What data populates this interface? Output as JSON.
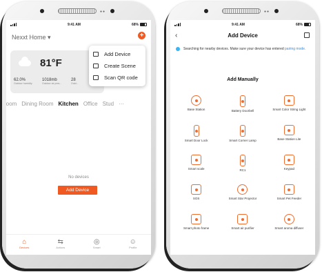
{
  "status": {
    "time": "9:41 AM",
    "battery": "68%"
  },
  "home": {
    "title": "Nexxt Home",
    "weather": {
      "temp": "81°F",
      "humidity": "62.0%",
      "humidity_label": "Outdoor humidity",
      "pressure": "1018mb",
      "pressure_label": "Outdoor air pres...",
      "third": "28",
      "third_label": "Outd..."
    },
    "menu": [
      {
        "label": "Add Device",
        "icon": "add-device-icon"
      },
      {
        "label": "Create Scene",
        "icon": "create-scene-icon"
      },
      {
        "label": "Scan QR code",
        "icon": "scan-qr-icon"
      }
    ],
    "rooms": [
      "room",
      "Dining Room",
      "Kitchen",
      "Office",
      "Stud",
      "···"
    ],
    "active_room": "Kitchen",
    "empty_text": "No devices",
    "add_button": "Add Device",
    "tabs": [
      {
        "label": "Devices",
        "icon": "home-icon",
        "active": true
      },
      {
        "label": "Actions",
        "icon": "actions-icon"
      },
      {
        "label": "Smart",
        "icon": "smart-icon"
      },
      {
        "label": "Profile",
        "icon": "profile-icon"
      }
    ]
  },
  "add_device": {
    "title": "Add Device",
    "search_text": "Searching for nearby devices. Make sure your device has entered",
    "search_link": "pairing mode.",
    "section": "Add Manually",
    "devices": [
      {
        "label": "Base Station",
        "shape": "round"
      },
      {
        "label": "Battery Doorbell",
        "shape": "tall"
      },
      {
        "label": "Smart Color String Light",
        "shape": ""
      },
      {
        "label": "Smart Door Lock",
        "shape": "tall"
      },
      {
        "label": "Smart Corner Lamp",
        "shape": "tall"
      },
      {
        "label": "Base Station Lite",
        "shape": ""
      },
      {
        "label": "Smart scale",
        "shape": ""
      },
      {
        "label": "RC1",
        "shape": "tall"
      },
      {
        "label": "Keypad",
        "shape": ""
      },
      {
        "label": "SOS",
        "shape": ""
      },
      {
        "label": "Smart Star Projector",
        "shape": "round"
      },
      {
        "label": "Smart Pet Feeder",
        "shape": ""
      },
      {
        "label": "Smart photo frame",
        "shape": ""
      },
      {
        "label": "Smart air purifier",
        "shape": ""
      },
      {
        "label": "Smart aroma diffuser",
        "shape": "round"
      }
    ]
  },
  "colors": {
    "accent": "#f05a22",
    "link": "#2f8fe6",
    "bluetooth": "#3ab4f2"
  }
}
